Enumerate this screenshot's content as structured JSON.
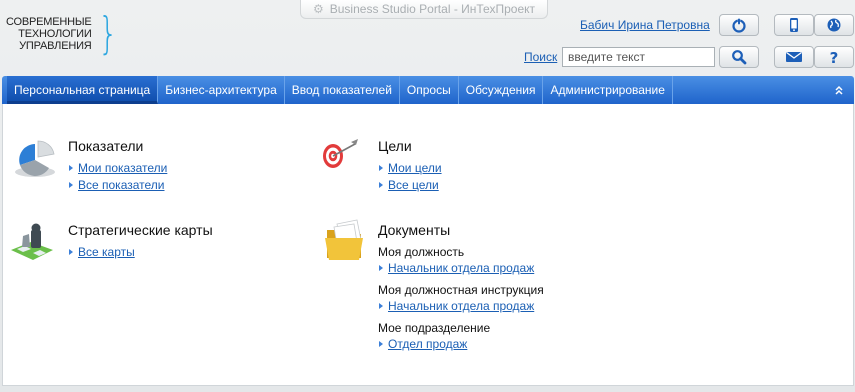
{
  "logo": {
    "line1": "СОВРЕМЕННЫЕ",
    "line2": "ТЕХНОЛОГИИ",
    "line3": "УПРАВЛЕНИЯ"
  },
  "header": {
    "window_title": "Business Studio Portal - ИнТехПроект",
    "user_name": "Бабич Ирина Петровна",
    "search_label": "Поиск",
    "search_placeholder": "введите текст"
  },
  "nav": {
    "items": [
      {
        "label": "Персональная страница"
      },
      {
        "label": "Бизнес-архитектура"
      },
      {
        "label": "Ввод показателей"
      },
      {
        "label": "Опросы"
      },
      {
        "label": "Обсуждения"
      },
      {
        "label": "Администрирование"
      }
    ]
  },
  "sections": {
    "indicators": {
      "title": "Показатели",
      "links": [
        "Мои показатели",
        "Все показатели"
      ]
    },
    "goals": {
      "title": "Цели",
      "links": [
        "Мои цели",
        "Все цели"
      ]
    },
    "maps": {
      "title": "Стратегические карты",
      "links": [
        "Все карты"
      ]
    },
    "documents": {
      "title": "Документы",
      "groups": [
        {
          "label": "Моя должность",
          "link": "Начальник отдела продаж"
        },
        {
          "label": "Моя должностная инструкция",
          "link": "Начальник отдела продаж"
        },
        {
          "label": "Мое подразделение",
          "link": "Отдел продаж"
        }
      ]
    }
  },
  "colors": {
    "accent": "#1f64cb",
    "link": "#1b5fb4",
    "logo_brace": "#2ea7e0"
  }
}
